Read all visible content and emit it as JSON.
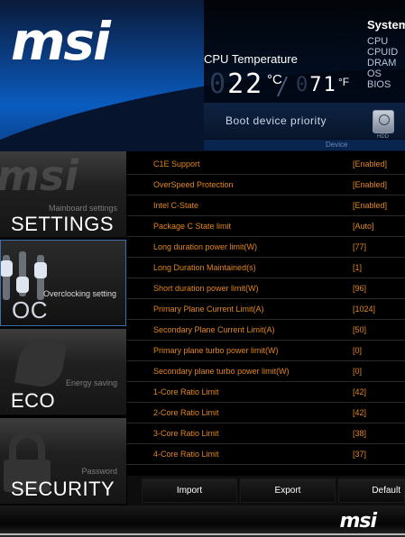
{
  "header": {
    "logo": "msi",
    "cpu_temp_label": "CPU Temperature",
    "temp_c": "22",
    "temp_c_unit": "°C",
    "temp_f": "71",
    "temp_f_unit": "°F",
    "system_title": "System",
    "system_items": [
      "CPU",
      "CPUID",
      "DRAM",
      "OS",
      "BIOS"
    ],
    "boot_label": "Boot device priority",
    "hdd_label": "HDD",
    "device_label": "Device"
  },
  "sidebar": {
    "items": [
      {
        "sub": "Mainboard settings",
        "label": "SETTINGS",
        "icon": "msi-logo-icon"
      },
      {
        "sub": "Overclocking setting",
        "label": "OC",
        "icon": "slider-icon",
        "active": true
      },
      {
        "sub": "Energy saving",
        "label": "ECO",
        "icon": "leaf-icon"
      },
      {
        "sub": "Password",
        "label": "SECURITY",
        "icon": "lock-icon"
      }
    ]
  },
  "settings": [
    {
      "label": "C1E Support",
      "value": "[Enabled]"
    },
    {
      "label": "OverSpeed Protection",
      "value": "[Enabled]"
    },
    {
      "label": "Intel C-State",
      "value": "[Enabled]"
    },
    {
      "label": "Package C State limit",
      "value": "[Auto]"
    },
    {
      "label": "Long duration power limit(W)",
      "value": "[77]"
    },
    {
      "label": "Long Duration Maintained(s)",
      "value": "[1]"
    },
    {
      "label": "Short duration power limit(W)",
      "value": "[96]"
    },
    {
      "label": "Primary Plane Current Limit(A)",
      "value": "[1024]"
    },
    {
      "label": "Secondary Plane Current Limit(A)",
      "value": "[50]"
    },
    {
      "label": "Primary plane turbo power limit(W)",
      "value": "[0]"
    },
    {
      "label": "Secondary plane turbo power limit(W)",
      "value": "[0]"
    },
    {
      "label": "1-Core Ratio Limit",
      "value": "[42]"
    },
    {
      "label": "2-Core Ratio Limit",
      "value": "[42]"
    },
    {
      "label": "3-Core Ratio Limit",
      "value": "[38]"
    },
    {
      "label": "4-Core Ratio Limit",
      "value": "[37]"
    }
  ],
  "buttons": {
    "import": "Import",
    "export": "Export",
    "default": "Default"
  },
  "footer": {
    "logo": "msi"
  },
  "colors": {
    "setting_text": "#e2861f",
    "header_blue": "#0a5cc0"
  }
}
